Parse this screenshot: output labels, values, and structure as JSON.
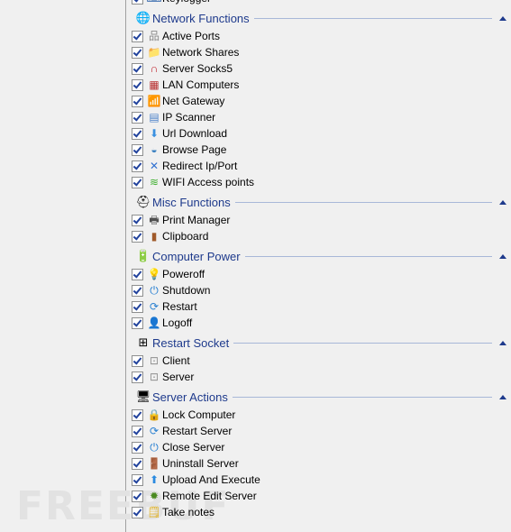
{
  "watermark": "FREEBUF",
  "partial_item": {
    "label": "Keylogger",
    "checked": true,
    "icon": "keylogger-icon"
  },
  "groups": [
    {
      "title": "Network Functions",
      "icon": "network-globe-icon",
      "glyph": "🌐",
      "items": [
        {
          "label": "Active Ports",
          "checked": true,
          "icon": "network-tree-icon",
          "glyph": "品"
        },
        {
          "label": "Network Shares",
          "checked": true,
          "icon": "shared-folder-icon",
          "glyph": "📁"
        },
        {
          "label": "Server Socks5",
          "checked": true,
          "icon": "magnet-icon",
          "glyph": "∩"
        },
        {
          "label": "LAN Computers",
          "checked": true,
          "icon": "firewall-icon",
          "glyph": "▦"
        },
        {
          "label": "Net Gateway",
          "checked": true,
          "icon": "router-icon",
          "glyph": "📶"
        },
        {
          "label": "IP Scanner",
          "checked": true,
          "icon": "scanner-icon",
          "glyph": "▤"
        },
        {
          "label": "Url Download",
          "checked": true,
          "icon": "download-icon",
          "glyph": "⬇"
        },
        {
          "label": "Browse Page",
          "checked": true,
          "icon": "browser-icon",
          "glyph": "◒"
        },
        {
          "label": "Redirect Ip/Port",
          "checked": true,
          "icon": "redirect-icon",
          "glyph": "✕"
        },
        {
          "label": "WIFI Access points",
          "checked": true,
          "icon": "wifi-icon",
          "glyph": "≋"
        }
      ]
    },
    {
      "title": "Misc Functions",
      "icon": "hardhat-add-icon",
      "glyph": "⛑",
      "items": [
        {
          "label": "Print Manager",
          "checked": true,
          "icon": "printer-icon",
          "glyph": "🖶"
        },
        {
          "label": "Clipboard",
          "checked": true,
          "icon": "clipboard-icon",
          "glyph": "▮"
        }
      ]
    },
    {
      "title": "Computer Power",
      "icon": "battery-icon",
      "glyph": "🔋",
      "items": [
        {
          "label": "Poweroff",
          "checked": true,
          "icon": "lightbulb-icon",
          "glyph": "💡"
        },
        {
          "label": "Shutdown",
          "checked": true,
          "icon": "power-icon",
          "glyph": "⏻"
        },
        {
          "label": "Restart",
          "checked": true,
          "icon": "refresh-icon",
          "glyph": "⟳"
        },
        {
          "label": "Logoff",
          "checked": true,
          "icon": "user-logoff-icon",
          "glyph": "👤"
        }
      ]
    },
    {
      "title": "Restart Socket",
      "icon": "socket-restart-icon",
      "glyph": "⊞",
      "items": [
        {
          "label": "Client",
          "checked": true,
          "icon": "socket-icon",
          "glyph": "⊡"
        },
        {
          "label": "Server",
          "checked": true,
          "icon": "socket-icon",
          "glyph": "⊡"
        }
      ]
    },
    {
      "title": "Server Actions",
      "icon": "server-computer-icon",
      "glyph": "🖥",
      "items": [
        {
          "label": "Lock Computer",
          "checked": true,
          "icon": "lock-icon",
          "glyph": "🔒"
        },
        {
          "label": "Restart Server",
          "checked": true,
          "icon": "refresh-icon",
          "glyph": "⟳"
        },
        {
          "label": "Close Server",
          "checked": true,
          "icon": "power-icon",
          "glyph": "⏻"
        },
        {
          "label": "Uninstall Server",
          "checked": true,
          "icon": "door-exit-icon",
          "glyph": "🚪"
        },
        {
          "label": "Upload And Execute",
          "checked": true,
          "icon": "upload-arrow-icon",
          "glyph": "⬆"
        },
        {
          "label": "Remote Edit Server",
          "checked": true,
          "icon": "bug-icon",
          "glyph": "✹"
        },
        {
          "label": "Take notes",
          "checked": true,
          "icon": "sticky-notes-icon",
          "glyph": "🗒"
        }
      ]
    }
  ],
  "colors": {
    "group_title": "#1e3a8c",
    "group_line": "#a8b8d8",
    "background": "#f0f0f0"
  }
}
